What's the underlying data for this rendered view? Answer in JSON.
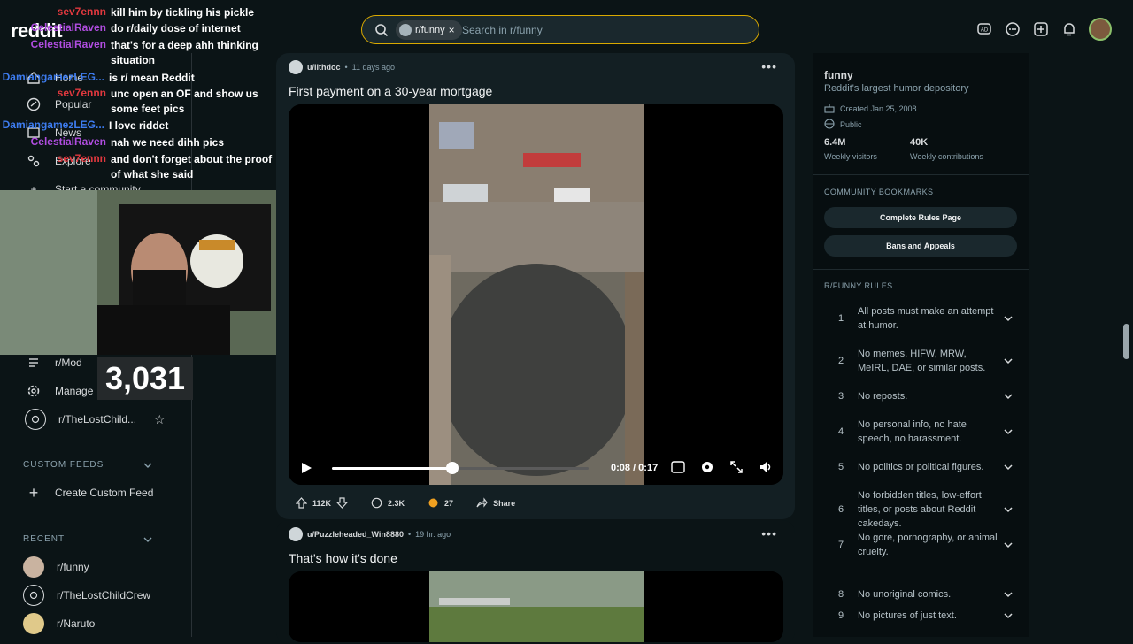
{
  "header": {
    "logo_text": "reddit",
    "search_chip": "r/funny",
    "search_placeholder": "Search in r/funny",
    "accent_color": "#d9a900"
  },
  "sidebar": {
    "nav": [
      {
        "label": "Home",
        "icon": "home-icon"
      },
      {
        "label": "Popular",
        "icon": "popular-icon"
      },
      {
        "label": "News",
        "icon": "news-icon"
      },
      {
        "label": "Explore",
        "icon": "explore-icon"
      },
      {
        "label": "Start a community",
        "icon": "plus-icon"
      }
    ],
    "mod_items": [
      {
        "label": "r/Mod",
        "icon": "mod-queue-icon"
      },
      {
        "label": "Manage",
        "icon": "gear-icon"
      },
      {
        "label": "r/TheLostChild...",
        "icon": "community-icon"
      }
    ],
    "custom_feeds_label": "CUSTOM FEEDS",
    "create_custom_feed": "Create Custom Feed",
    "recent_label": "RECENT",
    "recent": [
      {
        "label": "r/funny"
      },
      {
        "label": "r/TheLostChildCrew"
      },
      {
        "label": "r/Naruto"
      }
    ]
  },
  "overlay": {
    "chat": [
      {
        "name": "sev7ennn",
        "msg": "kill him by tickling his pickle",
        "color": "#e0383e"
      },
      {
        "name": "CelestialRaven",
        "msg": "do r/daily dose of internet",
        "color": "#b04de0"
      },
      {
        "name": "CelestialRaven",
        "msg": "that's for a deep ahh thinking situation",
        "color": "#b04de0"
      },
      {
        "name": "DamiangamezLEG...",
        "msg": "is r/ mean Reddit",
        "color": "#3d7cf0"
      },
      {
        "name": "sev7ennn",
        "msg": "unc open an OF and show us some feet pics",
        "color": "#e0383e"
      },
      {
        "name": "DamiangamezLEG...",
        "msg": "I love riddet",
        "color": "#3d7cf0"
      },
      {
        "name": "CelestialRaven",
        "msg": "nah we need dihh pics",
        "color": "#b04de0"
      },
      {
        "name": "sev7ennn",
        "msg": "and don't forget about the proof of what she said",
        "color": "#e0383e"
      }
    ],
    "counter": "3,031"
  },
  "posts": [
    {
      "user": "u/lithdoc",
      "time": "11 days ago",
      "title": "First payment on a 30-year mortgage",
      "video_time": "0:08 / 0:17",
      "progress": 0.47,
      "votes": "112K",
      "comments": "2.3K",
      "awards": "27",
      "share": "Share"
    },
    {
      "user": "u/Puzzleheaded_Win8880",
      "time": "19 hr. ago",
      "title": "That's how it's done"
    }
  ],
  "community": {
    "name": "funny",
    "description": "Reddit's largest humor depository",
    "created": "Created Jan 25, 2008",
    "visibility": "Public",
    "stats": [
      {
        "value": "6.4M",
        "label": "Weekly visitors"
      },
      {
        "value": "40K",
        "label": "Weekly contributions"
      }
    ],
    "bookmarks_heading": "COMMUNITY BOOKMARKS",
    "bookmarks": [
      "Complete Rules Page",
      "Bans and Appeals"
    ],
    "rules_heading": "R/FUNNY RULES",
    "rules": [
      {
        "num": "1",
        "text": "All posts must make an attempt at humor."
      },
      {
        "num": "2",
        "text": "No memes, HIFW, MRW, MeIRL, DAE, or similar posts."
      },
      {
        "num": "3",
        "text": "No reposts."
      },
      {
        "num": "4",
        "text": "No personal info, no hate speech, no harassment."
      },
      {
        "num": "5",
        "text": "No politics or political figures."
      },
      {
        "num": "6",
        "text": "No forbidden titles, low-effort titles, or posts about Reddit cakedays."
      },
      {
        "num": "7",
        "text": "No gore, pornography, or animal cruelty."
      },
      {
        "num": "8",
        "text": "No unoriginal comics."
      },
      {
        "num": "9",
        "text": "No pictures of just text."
      }
    ]
  }
}
